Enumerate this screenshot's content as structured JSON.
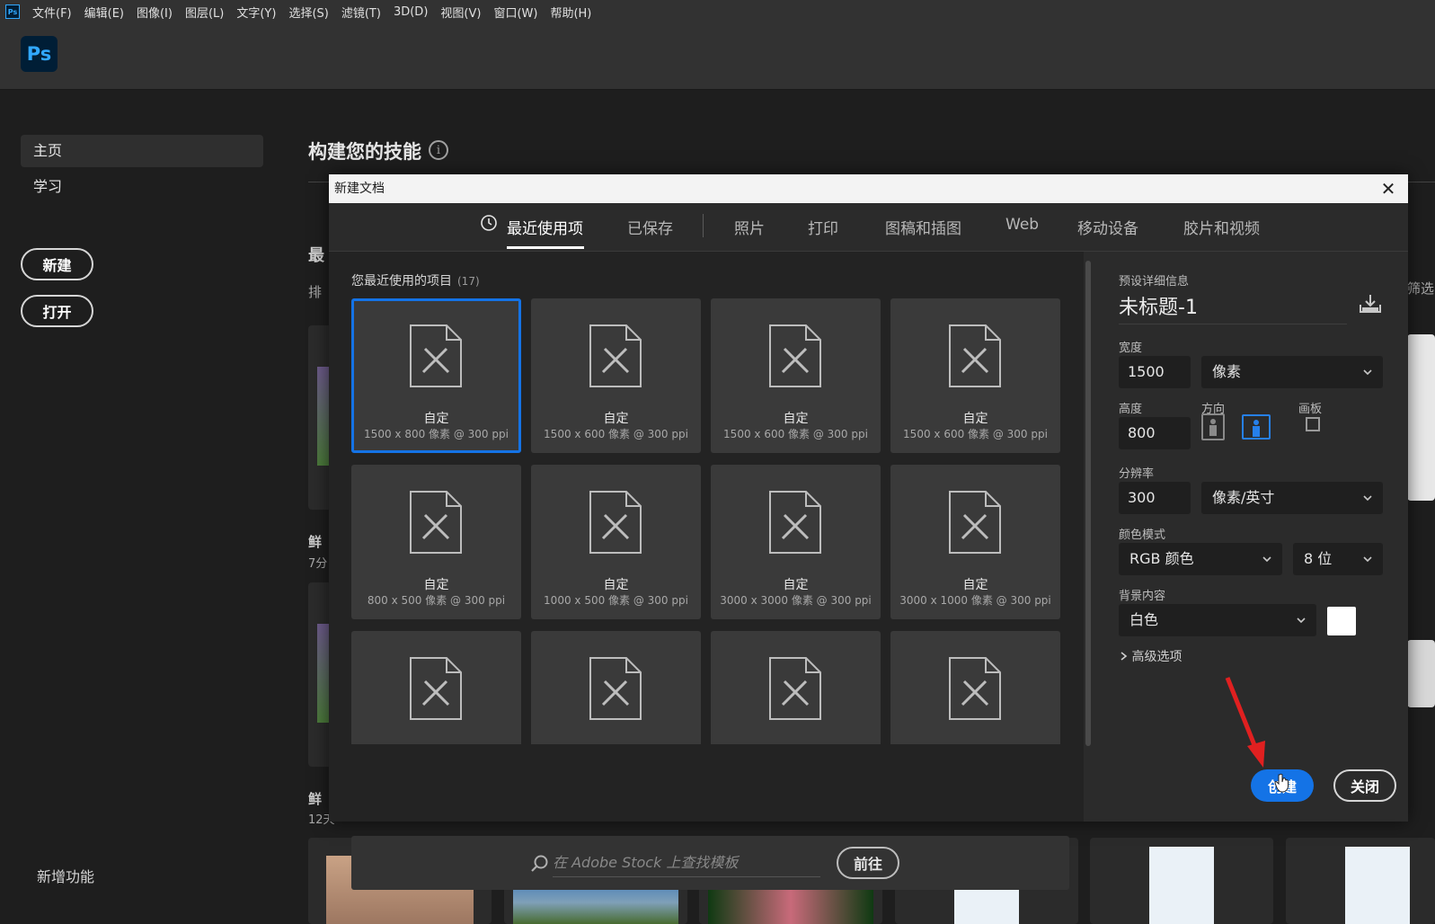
{
  "menubar": {
    "items": [
      "文件(F)",
      "编辑(E)",
      "图像(I)",
      "图层(L)",
      "文字(Y)",
      "选择(S)",
      "滤镜(T)",
      "3D(D)",
      "视图(V)",
      "窗口(W)",
      "帮助(H)"
    ]
  },
  "header": {
    "logo": "Ps"
  },
  "nav": {
    "home": "主页",
    "learn": "学习",
    "new_button": "新建",
    "open_button": "打开",
    "new_features": "新增功能"
  },
  "home": {
    "title": "构建您的技能",
    "info": "i",
    "recent_partial": "最",
    "sort_partial": "排",
    "filter_partial": "筛选",
    "item1_title": "鲜",
    "item1_time": "7分",
    "item2_title": "鲜",
    "item2_time": "12天"
  },
  "dialog": {
    "title": "新建文档",
    "close": "✕",
    "tabs": [
      "最近使用项",
      "已保存",
      "照片",
      "打印",
      "图稿和插图",
      "Web",
      "移动设备",
      "胶片和视频"
    ],
    "recent_label": "您最近使用的项目",
    "recent_count": "(17)",
    "presets": [
      {
        "name": "自定",
        "size": "1500 x 800 像素 @ 300 ppi",
        "selected": true
      },
      {
        "name": "自定",
        "size": "1500 x 600 像素 @ 300 ppi"
      },
      {
        "name": "自定",
        "size": "1500 x 600 像素 @ 300 ppi"
      },
      {
        "name": "自定",
        "size": "1500 x 600 像素 @ 300 ppi"
      },
      {
        "name": "自定",
        "size": "800 x 500 像素 @ 300 ppi"
      },
      {
        "name": "自定",
        "size": "1000 x 500 像素 @ 300 ppi"
      },
      {
        "name": "自定",
        "size": "3000 x 3000 像素 @ 300 ppi"
      },
      {
        "name": "自定",
        "size": "3000 x 1000 像素 @ 300 ppi"
      },
      {
        "name": "",
        "size": ""
      },
      {
        "name": "",
        "size": ""
      },
      {
        "name": "",
        "size": ""
      },
      {
        "name": "",
        "size": ""
      }
    ],
    "stock_placeholder": "在 Adobe Stock 上查找模板",
    "goto_button": "前往",
    "details": {
      "header": "预设详细信息",
      "preset_name": "未标题-1",
      "width_label": "宽度",
      "width_value": "1500",
      "width_unit": "像素",
      "height_label": "高度",
      "height_value": "800",
      "orientation_label": "方向",
      "artboard_label": "画板",
      "resolution_label": "分辨率",
      "resolution_value": "300",
      "resolution_unit": "像素/英寸",
      "color_mode_label": "颜色模式",
      "color_mode": "RGB 颜色",
      "bit_depth": "8 位",
      "background_label": "背景内容",
      "background": "白色",
      "background_color": "#ffffff",
      "advanced": "高级选项",
      "create_button": "创建",
      "close_button": "关闭"
    }
  },
  "colors": {
    "accent": "#1473e6",
    "bg": "#1e1e1e",
    "panel": "#2b2b2b",
    "annotation_arrow": "#e02020"
  }
}
